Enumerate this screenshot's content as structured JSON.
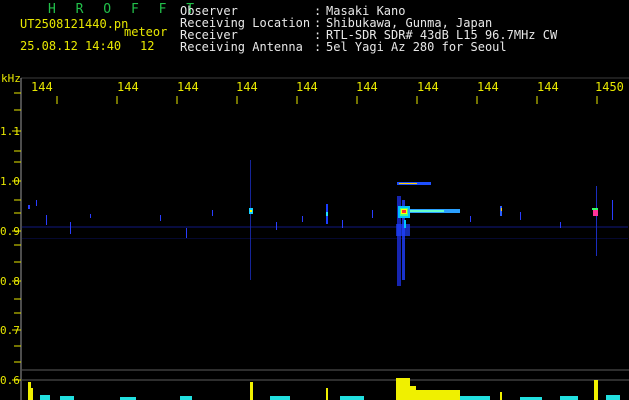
{
  "header": {
    "station": "H R O F F T",
    "filename": "UT2508121440.pn",
    "mode": "meteor",
    "datetime": "25.08.12 14:40",
    "count": "12",
    "fields": [
      {
        "label": "Observer",
        "sep": ":",
        "value": "Masaki Kano"
      },
      {
        "label": "Receiving Location",
        "sep": ":",
        "value": "Shibukawa, Gunma, Japan"
      },
      {
        "label": "Receiver",
        "sep": ":",
        "value": "RTL-SDR SDR# 43dB L15 96.7MHz CW"
      },
      {
        "label": "Receiving Antenna",
        "sep": ":",
        "value": "5el Yagi Az 280 for Seoul"
      }
    ]
  },
  "spectrogram": {
    "unit_label": "kHz",
    "y_ticks": [
      "1.1",
      "1.0",
      "0.9",
      "0.8",
      "0.7",
      "0.6"
    ],
    "time_ticks": [
      "144",
      "144",
      "144",
      "144",
      "144",
      "144",
      "144",
      "144",
      "144",
      "1450"
    ],
    "colors": {
      "text": "#e8e800",
      "fg": "#e8e8e8",
      "accent": "#22c04a",
      "grid": "#9a9a9a",
      "blue": "#2233ff"
    }
  }
}
